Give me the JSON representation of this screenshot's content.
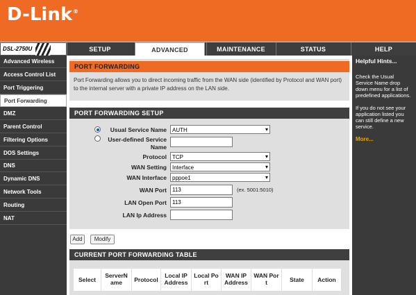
{
  "brand": {
    "logo": "D-Link",
    "model": "DSL-2750U"
  },
  "nav": {
    "tabs": [
      {
        "label": "SETUP"
      },
      {
        "label": "ADVANCED"
      },
      {
        "label": "MAINTENANCE"
      },
      {
        "label": "STATUS"
      },
      {
        "label": "HELP"
      }
    ],
    "active_tab": "ADVANCED"
  },
  "sidebar": {
    "items": [
      {
        "label": "Advanced Wireless"
      },
      {
        "label": "Access Control List"
      },
      {
        "label": "Port Triggering"
      },
      {
        "label": "Port Forwarding"
      },
      {
        "label": "DMZ"
      },
      {
        "label": "Parent Control"
      },
      {
        "label": "Filtering Options"
      },
      {
        "label": "DOS Settings"
      },
      {
        "label": "DNS"
      },
      {
        "label": "Dynamic DNS"
      },
      {
        "label": "Network Tools"
      },
      {
        "label": "Routing"
      },
      {
        "label": "NAT"
      }
    ],
    "active_item": "Port Forwarding"
  },
  "port_forwarding": {
    "title": "PORT FORWARDING",
    "description": "Port Forwarding allows you to direct incoming traffic from the WAN side (identified by Protocol and WAN port) to the internal server with a private IP address on the LAN side."
  },
  "setup": {
    "title": "PORT FORWARDING SETUP",
    "usual_service_label": "Usual Service Name",
    "usual_service_value": "AUTH",
    "user_defined_label_1": "User-defined Service",
    "user_defined_label_2": "Name",
    "user_defined_value": "",
    "protocol_label": "Protocol",
    "protocol_value": "TCP",
    "wan_setting_label": "WAN Setting",
    "wan_setting_value": "Interface",
    "wan_interface_label": "WAN Interface",
    "wan_interface_value": "pppoe1",
    "wan_port_label": "WAN Port",
    "wan_port_value": "113",
    "wan_port_hint": "(ex. 5001:5010)",
    "lan_open_port_label": "LAN Open Port",
    "lan_open_port_value": "113",
    "lan_ip_label": "LAN Ip Address",
    "lan_ip_value": ""
  },
  "buttons": {
    "add": "Add",
    "modify": "Modify"
  },
  "table": {
    "title": "CURRENT PORT FORWARDING TABLE",
    "headers": [
      {
        "l1": "Select",
        "l2": ""
      },
      {
        "l1": "ServerN",
        "l2": "ame"
      },
      {
        "l1": "Protocol",
        "l2": ""
      },
      {
        "l1": "Local IP",
        "l2": "Address"
      },
      {
        "l1": "Local Po",
        "l2": "rt"
      },
      {
        "l1": "WAN IP",
        "l2": "Address"
      },
      {
        "l1": "WAN Por",
        "l2": "t"
      },
      {
        "l1": "State",
        "l2": ""
      },
      {
        "l1": "Action",
        "l2": ""
      }
    ]
  },
  "hints": {
    "title": "Helpful Hints...",
    "p1": "Check the Usual Service Name drop down menu for a list of predefined applications.",
    "p2": "If you do not see your application listed you can still define a new service.",
    "more": "More..."
  },
  "colors": {
    "brand_orange": "#ef6a22",
    "dark_bar": "#3a3a3a",
    "panel_gray": "#dfdfdf",
    "hint_link": "#f0a300"
  }
}
